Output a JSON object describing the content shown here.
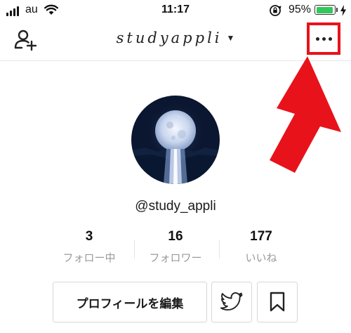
{
  "status_bar": {
    "carrier": "au",
    "time": "11:17",
    "battery_percent": "95%",
    "battery_level": 0.95,
    "icons": [
      "signal-icon",
      "wifi-icon",
      "rotation-lock-icon",
      "battery-icon",
      "charging-bolt-icon"
    ]
  },
  "header": {
    "username_title": "studyappli",
    "icons": [
      "add-user-icon",
      "chevron-down-icon",
      "more-icon"
    ]
  },
  "annotation": {
    "highlight_color": "#e8121b"
  },
  "profile": {
    "handle": "@study_appli",
    "stats": [
      {
        "value": "3",
        "label": "フォロー中"
      },
      {
        "value": "16",
        "label": "フォロワー"
      },
      {
        "value": "177",
        "label": "いいね"
      }
    ],
    "edit_button_label": "プロフィールを編集",
    "action_icons": [
      "twitter-icon",
      "bookmark-icon"
    ]
  }
}
